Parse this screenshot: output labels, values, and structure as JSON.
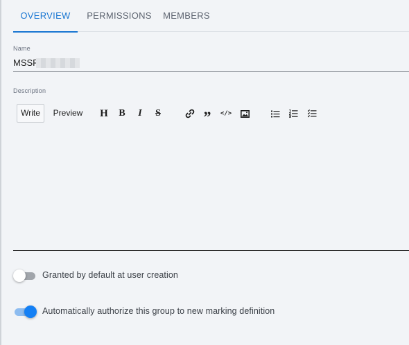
{
  "tabs": [
    {
      "label": "OVERVIEW",
      "active": true
    },
    {
      "label": "PERMISSIONS",
      "active": false
    },
    {
      "label": "MEMBERS",
      "active": false
    }
  ],
  "name_field": {
    "label": "Name",
    "value": "MSSP"
  },
  "description": {
    "label": "Description",
    "write_label": "Write",
    "preview_label": "Preview",
    "toolbar_icons": {
      "heading": "H",
      "bold": "B",
      "italic": "I",
      "strikethrough": "S",
      "link": "link-icon",
      "quote": "”",
      "code": "</>",
      "image": "image-icon",
      "unordered_list": "unordered-list-icon",
      "ordered_list": "ordered-list-icon",
      "task_list": "checklist-icon"
    },
    "value": ""
  },
  "toggles": [
    {
      "label": "Granted by default at user creation",
      "checked": false
    },
    {
      "label": "Automatically authorize this group to new marking definition",
      "checked": true
    }
  ],
  "colors": {
    "accent": "#1976d2",
    "switch_on_thumb": "#1480f5",
    "switch_on_track": "#8dbcf0",
    "switch_off_track": "#a1a5ab",
    "background": "#f2f4f7"
  }
}
